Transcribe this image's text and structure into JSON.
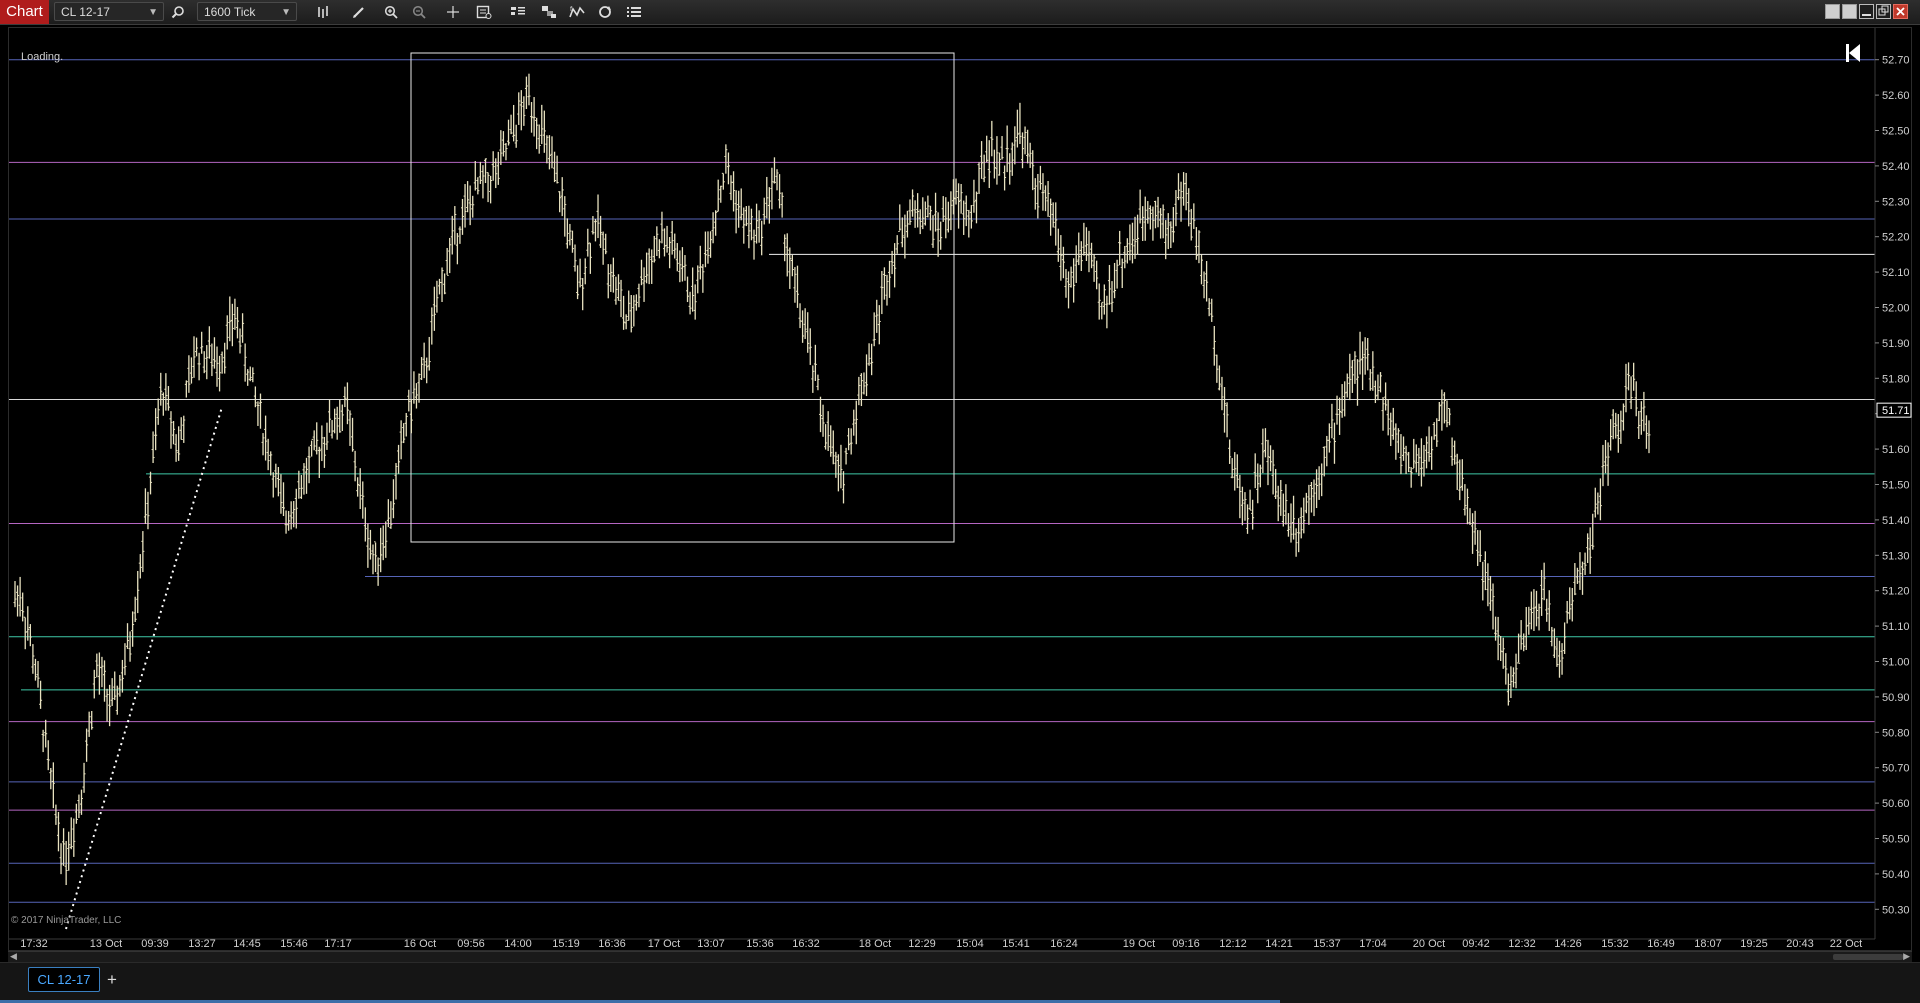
{
  "app": {
    "tab_label": "Chart"
  },
  "toolbar": {
    "instrument": "CL 12-17",
    "interval": "1600 Tick",
    "icons": [
      "search-icon",
      "bar-type-icon",
      "drawing-tool-icon",
      "zoom-in-icon",
      "zoom-out-icon",
      "crosshair-icon",
      "data-box-icon",
      "chart-trader-icon",
      "templates-icon",
      "indicators-icon",
      "strategies-icon",
      "properties-icon"
    ]
  },
  "window_controls": [
    "restore-icon",
    "tile-icon",
    "minimize-icon",
    "maximize-icon",
    "close-icon"
  ],
  "chart": {
    "status": "Loading.",
    "copyright": "© 2017 NinjaTrader, LLC",
    "price_marker": "51.71",
    "background": "#000000",
    "colors": {
      "bars": "#e8e2c0",
      "marker": "#ffffff"
    }
  },
  "chart_data": {
    "type": "bar",
    "ylim": [
      50.25,
      52.75
    ],
    "y_ticks": [
      "52.70",
      "52.60",
      "52.50",
      "52.40",
      "52.30",
      "52.20",
      "52.10",
      "52.00",
      "51.90",
      "51.80",
      "51.70",
      "51.60",
      "51.50",
      "51.40",
      "51.30",
      "51.20",
      "51.10",
      "51.00",
      "50.90",
      "50.80",
      "50.70",
      "50.60",
      "50.50",
      "50.40",
      "50.30"
    ],
    "x_ticks": [
      "17:32",
      "13 Oct",
      "09:39",
      "13:27",
      "14:45",
      "15:46",
      "17:17",
      "16 Oct",
      "09:56",
      "14:00",
      "15:19",
      "16:36",
      "17 Oct",
      "13:07",
      "15:36",
      "16:32",
      "18 Oct",
      "12:29",
      "15:04",
      "15:41",
      "16:24",
      "19 Oct",
      "09:16",
      "12:12",
      "14:21",
      "15:37",
      "17:04",
      "20 Oct",
      "09:42",
      "12:32",
      "14:26",
      "15:32",
      "16:49",
      "18:07",
      "19:25",
      "20:43",
      "22 Oct"
    ],
    "price_path": [
      [
        0,
        51.18
      ],
      [
        0.3,
        51.2
      ],
      [
        1.2,
        51.0
      ],
      [
        2.2,
        50.65
      ],
      [
        3.0,
        50.44
      ],
      [
        4.0,
        50.62
      ],
      [
        5.0,
        50.98
      ],
      [
        6.0,
        50.86
      ],
      [
        7.0,
        51.05
      ],
      [
        8.0,
        51.4
      ],
      [
        9.0,
        51.78
      ],
      [
        10.0,
        51.6
      ],
      [
        11.0,
        51.88
      ],
      [
        12.5,
        51.85
      ],
      [
        13.5,
        51.98
      ],
      [
        14.5,
        51.78
      ],
      [
        15.5,
        51.6
      ],
      [
        16.5,
        51.4
      ],
      [
        17.5,
        51.5
      ],
      [
        18.5,
        51.6
      ],
      [
        19.5,
        51.68
      ],
      [
        20.3,
        51.72
      ],
      [
        21.0,
        51.5
      ],
      [
        22.0,
        51.27
      ],
      [
        23.0,
        51.42
      ],
      [
        24.0,
        51.7
      ],
      [
        25.0,
        51.8
      ],
      [
        26.0,
        52.05
      ],
      [
        27.0,
        52.22
      ],
      [
        28.5,
        52.35
      ],
      [
        29.5,
        52.38
      ],
      [
        30.5,
        52.5
      ],
      [
        31.5,
        52.6
      ],
      [
        32.5,
        52.45
      ],
      [
        33.5,
        52.3
      ],
      [
        34.5,
        52.05
      ],
      [
        35.5,
        52.25
      ],
      [
        36.5,
        52.1
      ],
      [
        37.5,
        51.95
      ],
      [
        38.5,
        52.1
      ],
      [
        39.5,
        52.2
      ],
      [
        40.5,
        52.15
      ],
      [
        41.5,
        52.02
      ],
      [
        42.5,
        52.2
      ],
      [
        43.5,
        52.4
      ],
      [
        44.5,
        52.25
      ],
      [
        45.5,
        52.2
      ],
      [
        46.5,
        52.38
      ],
      [
        47.5,
        52.1
      ],
      [
        48.5,
        51.9
      ],
      [
        49.5,
        51.68
      ],
      [
        50.5,
        51.5
      ],
      [
        51.5,
        51.72
      ],
      [
        52.5,
        51.9
      ],
      [
        53.5,
        52.12
      ],
      [
        54.5,
        52.25
      ],
      [
        55.5,
        52.28
      ],
      [
        56.5,
        52.22
      ],
      [
        57.5,
        52.3
      ],
      [
        58.5,
        52.25
      ],
      [
        59.5,
        52.45
      ],
      [
        60.5,
        52.4
      ],
      [
        61.5,
        52.5
      ],
      [
        62.5,
        52.35
      ],
      [
        63.5,
        52.25
      ],
      [
        64.5,
        52.05
      ],
      [
        65.5,
        52.2
      ],
      [
        66.5,
        51.98
      ],
      [
        67.5,
        52.12
      ],
      [
        68.5,
        52.2
      ],
      [
        69.5,
        52.3
      ],
      [
        70.5,
        52.2
      ],
      [
        71.5,
        52.35
      ],
      [
        72.5,
        52.15
      ],
      [
        73.5,
        51.9
      ],
      [
        74.5,
        51.55
      ],
      [
        75.5,
        51.42
      ],
      [
        76.5,
        51.6
      ],
      [
        77.5,
        51.45
      ],
      [
        78.5,
        51.38
      ],
      [
        79.5,
        51.5
      ],
      [
        80.5,
        51.62
      ],
      [
        81.5,
        51.78
      ],
      [
        82.5,
        51.85
      ],
      [
        83.5,
        51.78
      ],
      [
        84.5,
        51.62
      ],
      [
        85.5,
        51.55
      ],
      [
        86.5,
        51.6
      ],
      [
        87.5,
        51.72
      ],
      [
        88.5,
        51.5
      ],
      [
        89.5,
        51.35
      ],
      [
        90.5,
        51.12
      ],
      [
        91.5,
        50.92
      ],
      [
        92.5,
        51.08
      ],
      [
        93.5,
        51.2
      ],
      [
        94.5,
        51.0
      ],
      [
        95.5,
        51.22
      ],
      [
        96.5,
        51.35
      ],
      [
        97.5,
        51.6
      ],
      [
        98.5,
        51.72
      ],
      [
        99.0,
        51.8
      ],
      [
        99.5,
        51.65
      ],
      [
        100,
        51.68
      ]
    ]
  }
}
